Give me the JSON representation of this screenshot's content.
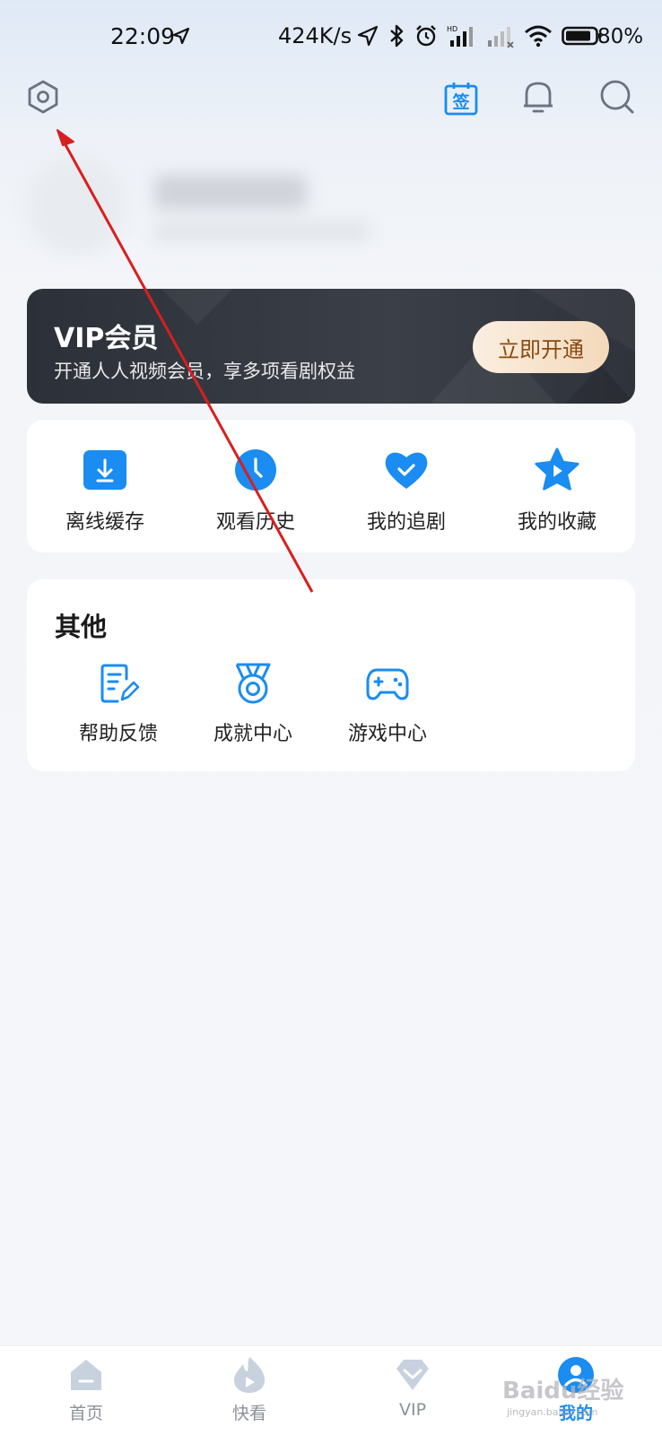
{
  "status_bar": {
    "time": "22:09",
    "net_speed": "424K/s",
    "battery": "80%"
  },
  "top_bar": {
    "sign_label": "签"
  },
  "vip": {
    "title": "VIP会员",
    "subtitle": "开通人人视频会员，享多项看剧权益",
    "button": "立即开通"
  },
  "quick_actions": [
    {
      "label": "离线缓存",
      "icon": "download-icon"
    },
    {
      "label": "观看历史",
      "icon": "clock-icon"
    },
    {
      "label": "我的追剧",
      "icon": "heart-icon"
    },
    {
      "label": "我的收藏",
      "icon": "star-icon"
    }
  ],
  "other": {
    "title": "其他",
    "items": [
      {
        "label": "帮助反馈",
        "icon": "feedback-icon"
      },
      {
        "label": "成就中心",
        "icon": "medal-icon"
      },
      {
        "label": "游戏中心",
        "icon": "gamepad-icon"
      }
    ]
  },
  "bottom_nav": [
    {
      "label": "首页",
      "icon": "home-icon"
    },
    {
      "label": "快看",
      "icon": "flame-icon"
    },
    {
      "label": "VIP",
      "icon": "vip-icon"
    },
    {
      "label": "我的",
      "icon": "profile-icon",
      "active": true
    }
  ],
  "watermark": {
    "text": "Baidu经验",
    "sub": "jingyan.baidu.com"
  },
  "colors": {
    "accent": "#1a8cf2",
    "vip_bg": "#2c3139",
    "vip_button": "#f3d9bb",
    "annotation": "#d81f1f"
  }
}
